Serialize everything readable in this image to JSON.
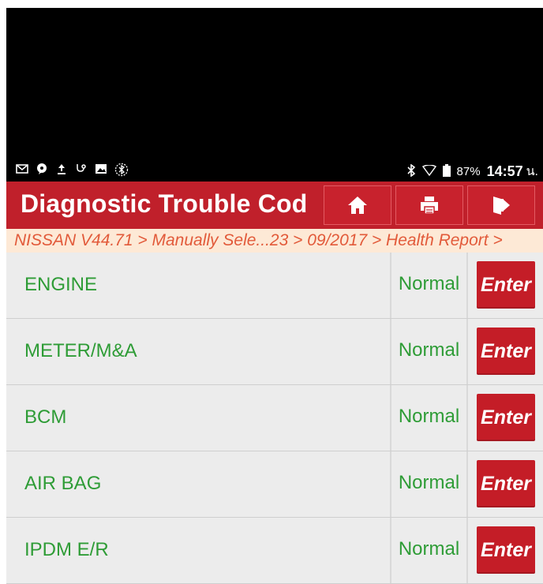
{
  "status_bar": {
    "left_icons": [
      "mail-icon",
      "chat-icon",
      "upload-icon",
      "stethoscope-icon",
      "image-icon",
      "bluetooth-circle-icon"
    ],
    "right_icons": [
      "bluetooth-icon",
      "wifi-icon",
      "battery-icon"
    ],
    "battery": "87%",
    "time": "14:57",
    "ampm": "น."
  },
  "header": {
    "title": "Diagnostic Trouble Cod",
    "buttons": [
      {
        "name": "home",
        "icon": "home-icon"
      },
      {
        "name": "print",
        "icon": "print-icon"
      },
      {
        "name": "exit",
        "icon": "exit-icon"
      }
    ],
    "color": "#c0202b"
  },
  "breadcrumb": "NISSAN V44.71 > Manually Sele...23 > 09/2017 > Health Report >",
  "systems": [
    {
      "name": "ENGINE",
      "status": "Normal",
      "action": "Enter"
    },
    {
      "name": "METER/M&A",
      "status": "Normal",
      "action": "Enter"
    },
    {
      "name": "BCM",
      "status": "Normal",
      "action": "Enter"
    },
    {
      "name": "AIR BAG",
      "status": "Normal",
      "action": "Enter"
    },
    {
      "name": "IPDM E/R",
      "status": "Normal",
      "action": "Enter"
    }
  ],
  "colors": {
    "accent_red": "#c0202b",
    "text_green": "#2e9c36",
    "breadcrumb_orange": "#e25a3a"
  }
}
